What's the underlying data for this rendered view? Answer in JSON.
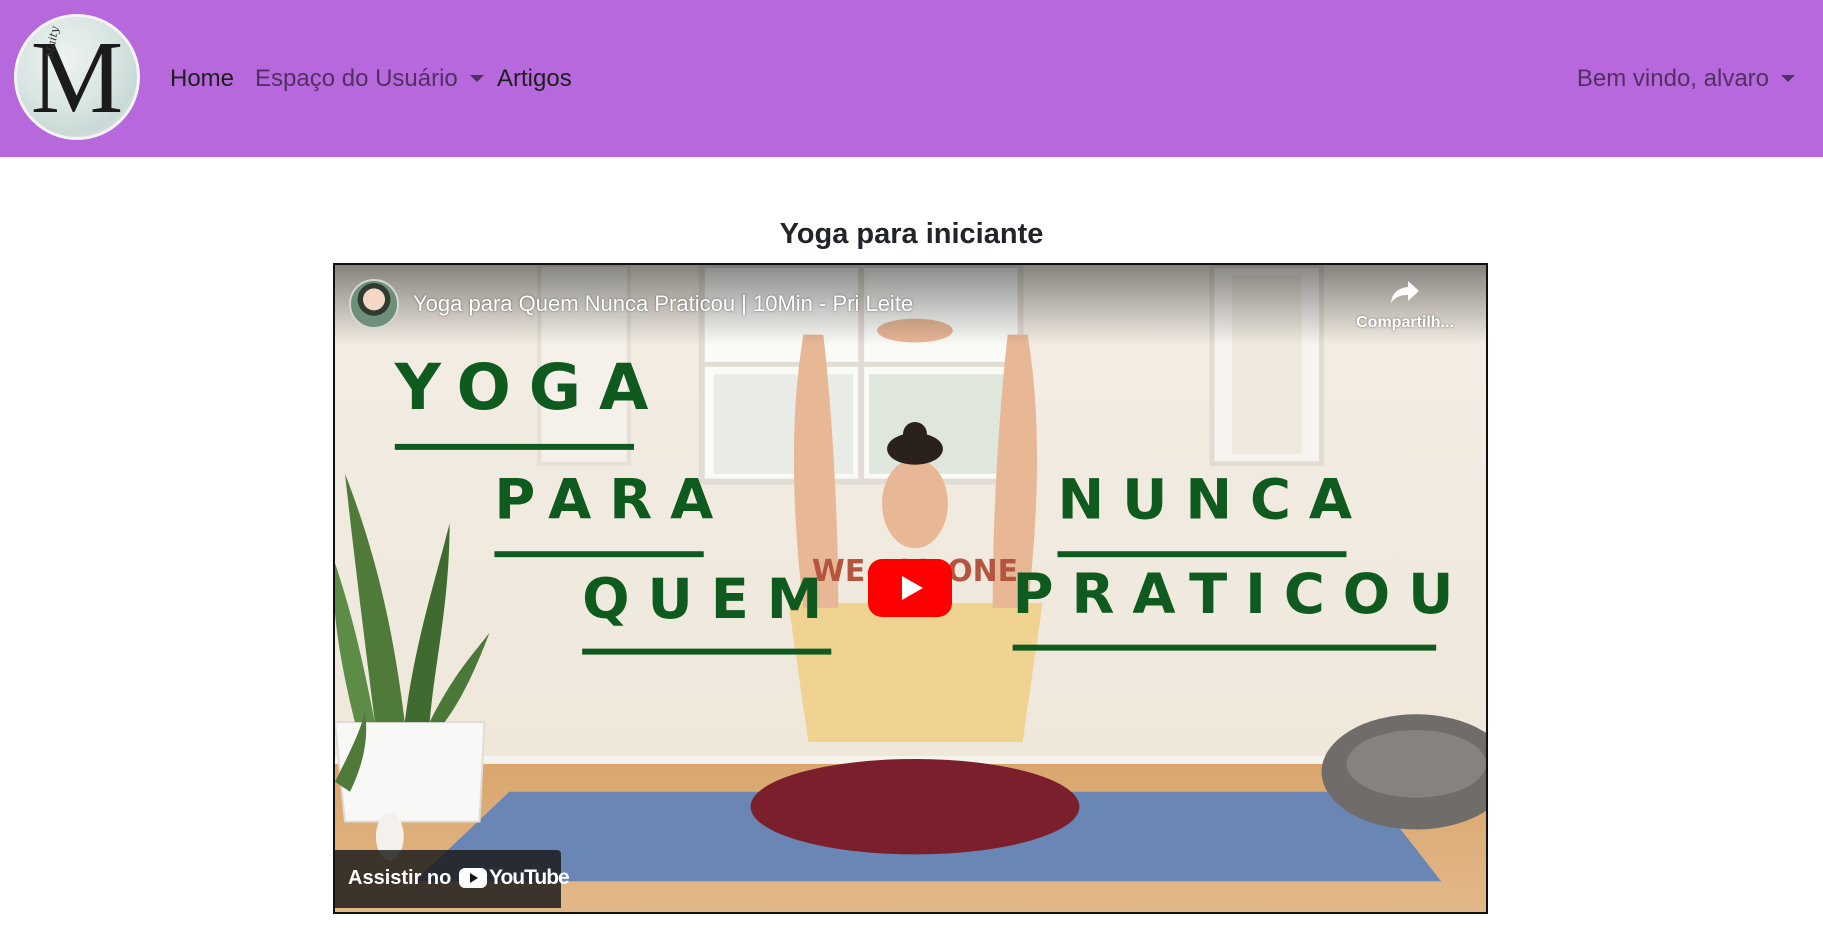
{
  "nav": {
    "logo_letter": "M",
    "logo_script": "Maity",
    "home": "Home",
    "user_space": "Espaço do Usuário",
    "articles": "Artigos",
    "welcome": "Bem vindo, alvaro"
  },
  "page": {
    "title": "Yoga para iniciante"
  },
  "video": {
    "title": "Yoga para Quem Nunca Praticou | 10Min - Pri Leite",
    "share_label": "Compartilh...",
    "watch_on": "Assistir no",
    "youtube_word": "YouTube",
    "thumbnail_words": [
      "YOGA",
      "PARA",
      "QUEM",
      "NUNCA",
      "PRATICOU"
    ],
    "shirt_text": "WE ALL ONE"
  },
  "colors": {
    "navbar": "#b768dc",
    "thumbnail_text": "#0f5a1e",
    "play_button": "#ff0000"
  }
}
